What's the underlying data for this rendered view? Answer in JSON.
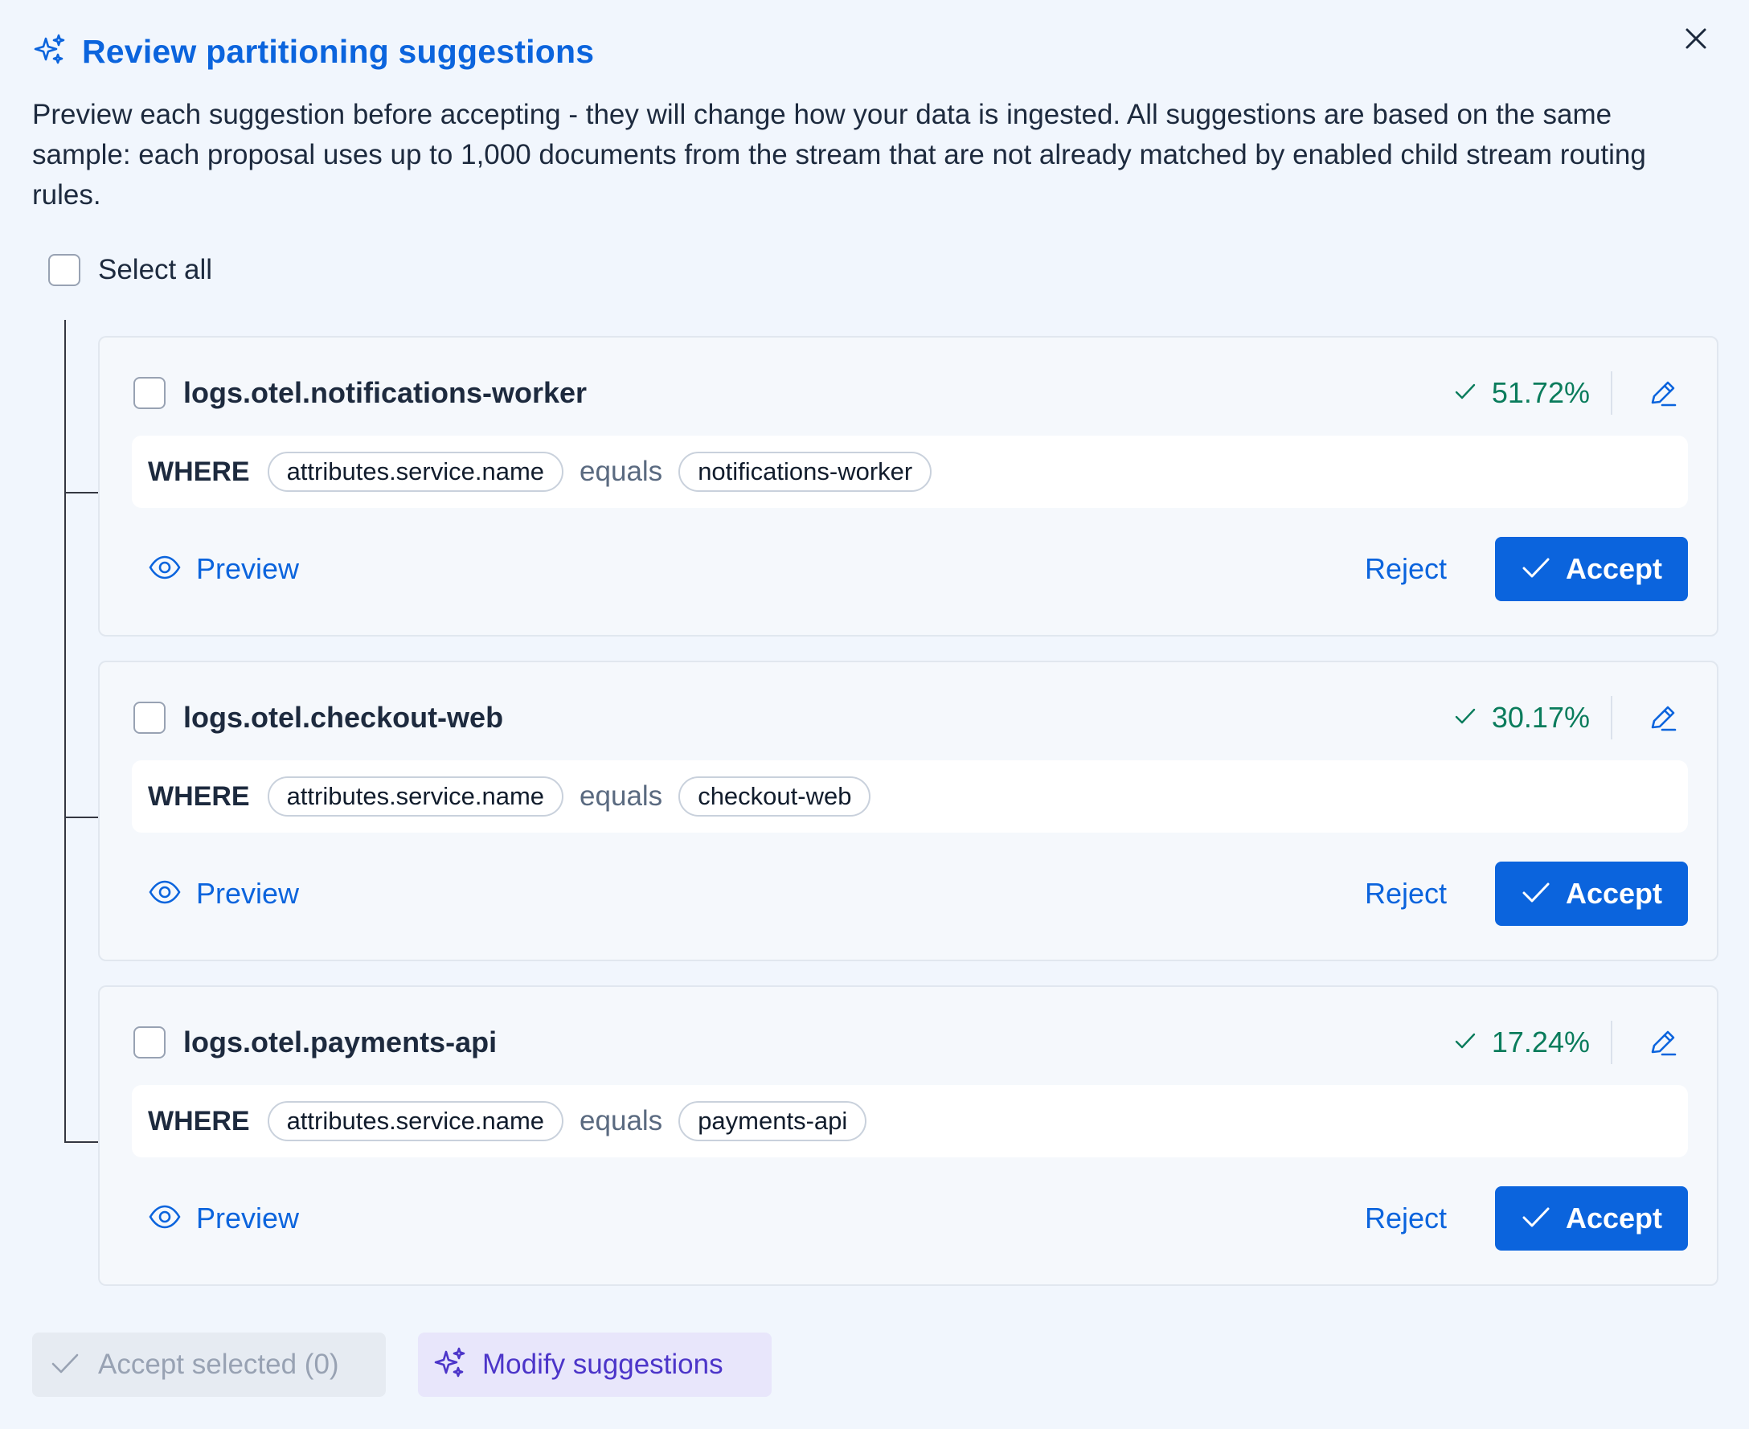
{
  "dialog": {
    "title": "Review partitioning suggestions",
    "description": "Preview each suggestion before accepting - they will change how your data is ingested. All suggestions are based on the same sample: each proposal uses up to 1,000 documents from the stream that are not already matched by enabled child stream routing rules.",
    "close_icon": "close-icon",
    "title_icon": "sparkles-icon"
  },
  "select_all": {
    "label": "Select all",
    "checked": false
  },
  "suggestions": [
    {
      "stream": "logs.otel.notifications-worker",
      "match_pct": "51.72%",
      "where": "WHERE",
      "field": "attributes.service.name",
      "operator": "equals",
      "value": "notifications-worker",
      "preview_label": "Preview",
      "reject_label": "Reject",
      "accept_label": "Accept"
    },
    {
      "stream": "logs.otel.checkout-web",
      "match_pct": "30.17%",
      "where": "WHERE",
      "field": "attributes.service.name",
      "operator": "equals",
      "value": "checkout-web",
      "preview_label": "Preview",
      "reject_label": "Reject",
      "accept_label": "Accept"
    },
    {
      "stream": "logs.otel.payments-api",
      "match_pct": "17.24%",
      "where": "WHERE",
      "field": "attributes.service.name",
      "operator": "equals",
      "value": "payments-api",
      "preview_label": "Preview",
      "reject_label": "Reject",
      "accept_label": "Accept"
    }
  ],
  "footer": {
    "accept_selected_label": "Accept selected (0)",
    "modify_label": "Modify suggestions"
  },
  "colors": {
    "primary": "#0b64dd",
    "success": "#0a7c5c",
    "background": "#f1f6fd",
    "ai_accent": "#4c35c9"
  }
}
